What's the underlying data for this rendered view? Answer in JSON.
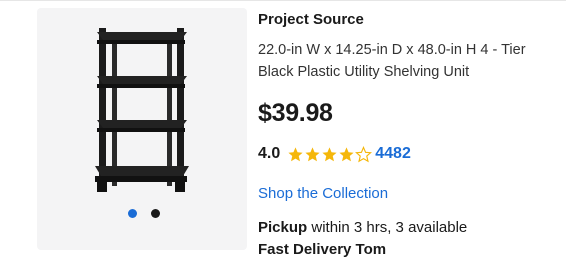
{
  "gallery": {
    "image_alt": "Black plastic 4-tier shelving unit",
    "dots": [
      "active",
      "inactive"
    ]
  },
  "product": {
    "brand": "Project Source",
    "title": "22.0-in W x 14.25-in D x 48.0-in H 4 - Tier Black Plastic Utility Shelving Unit",
    "price": "$39.98",
    "rating_value": "4.0",
    "rating_stars": 4,
    "review_count": "4482",
    "shop_link": "Shop the Collection",
    "pickup_label": "Pickup",
    "pickup_text": " within 3 hrs, 3 available",
    "delivery_partial": "Fast Delivery  Tom"
  },
  "colors": {
    "link": "#1a6cd6",
    "star": "#f5b70a",
    "gallery_bg": "#f4f4f5"
  }
}
